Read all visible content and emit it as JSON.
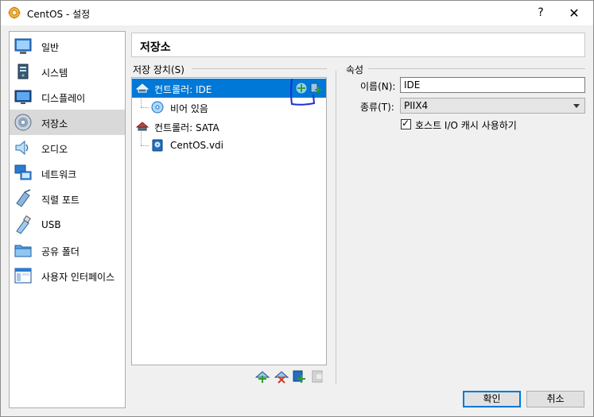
{
  "window": {
    "title": "CentOS - 설정",
    "help_glyph": "?",
    "close_glyph": "✕"
  },
  "sidebar": {
    "items": [
      {
        "label": "일반",
        "icon": "general-icon"
      },
      {
        "label": "시스템",
        "icon": "system-icon"
      },
      {
        "label": "디스플레이",
        "icon": "display-icon"
      },
      {
        "label": "저장소",
        "icon": "storage-icon",
        "selected": true
      },
      {
        "label": "오디오",
        "icon": "audio-icon"
      },
      {
        "label": "네트워크",
        "icon": "network-icon"
      },
      {
        "label": "직렬 포트",
        "icon": "serial-port-icon"
      },
      {
        "label": "USB",
        "icon": "usb-icon"
      },
      {
        "label": "공유 폴더",
        "icon": "shared-folder-icon"
      },
      {
        "label": "사용자 인터페이스",
        "icon": "user-interface-icon"
      }
    ]
  },
  "page": {
    "title": "저장소"
  },
  "storage_devices": {
    "group_label": "저장 장치(S)",
    "tree": [
      {
        "label": "컨트롤러: IDE",
        "type": "controller",
        "selected": true
      },
      {
        "label": "비어 있음",
        "type": "optical-drive"
      },
      {
        "label": "컨트롤러: SATA",
        "type": "controller"
      },
      {
        "label": "CentOS.vdi",
        "type": "hard-disk"
      }
    ]
  },
  "attributes": {
    "group_label": "속성",
    "name_label": "이름(N):",
    "name_value": "IDE",
    "type_label": "종류(T):",
    "type_value": "PIIX4",
    "host_io_cache_label": "호스트 I/O 캐시 사용하기",
    "host_io_cache_checked": true,
    "check_glyph": "✓"
  },
  "buttons": {
    "ok": "확인",
    "cancel": "취소"
  },
  "colors": {
    "selection": "#0078d7",
    "annotation": "#1f2fd6"
  }
}
